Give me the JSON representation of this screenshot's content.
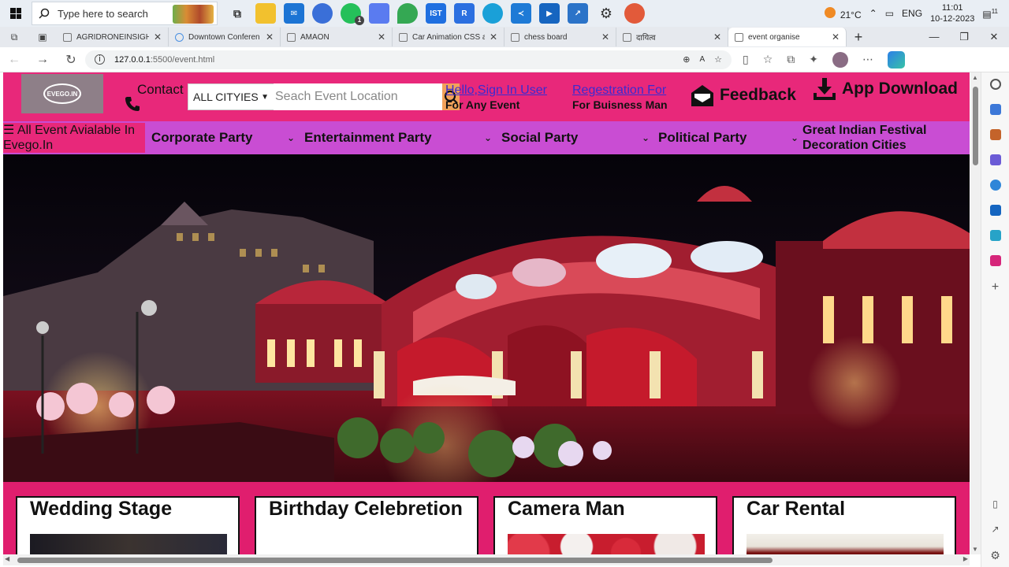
{
  "taskbar": {
    "search_placeholder": "Type here to search",
    "weather": "21°C",
    "language": "ENG",
    "time": "11:01",
    "date": "10-12-2023",
    "notif_count": "11",
    "whatsapp_badge": "1",
    "ist_label": "IST"
  },
  "browser": {
    "tabs": [
      {
        "label": "AGRIDRONEINSIGHT"
      },
      {
        "label": "Downtown Conferen"
      },
      {
        "label": "AMAON"
      },
      {
        "label": "Car Animation CSS ar"
      },
      {
        "label": "chess board"
      },
      {
        "label": "दायित्व"
      },
      {
        "label": "event organise"
      }
    ],
    "url_host": "127.0.0.1",
    "url_path": ":5500/event.html"
  },
  "site": {
    "logo_text": "EVEGO.IN",
    "contact": "Contact",
    "city_select": "ALL CITYIES",
    "search_placeholder": "Seach Event Location",
    "signin_line1": "Hello,Sign In User",
    "signin_line2": "For Any Event",
    "register_line1": "Regestration For",
    "register_line2": "For Buisness Man",
    "feedback": "Feedback",
    "app_download": "App Download",
    "all_events": "☰ All Event Avialable In Evego.In",
    "nav": [
      {
        "label": "Corporate Party"
      },
      {
        "label": "Entertainment Party"
      },
      {
        "label": "Social Party"
      },
      {
        "label": "Political Party"
      }
    ],
    "festival": "Great Indian Festival Decoration Cities",
    "cards": [
      {
        "title": "Wedding Stage"
      },
      {
        "title": "Birthday Celebretion"
      },
      {
        "title": "Camera Man"
      },
      {
        "title": "Car Rental"
      }
    ]
  }
}
